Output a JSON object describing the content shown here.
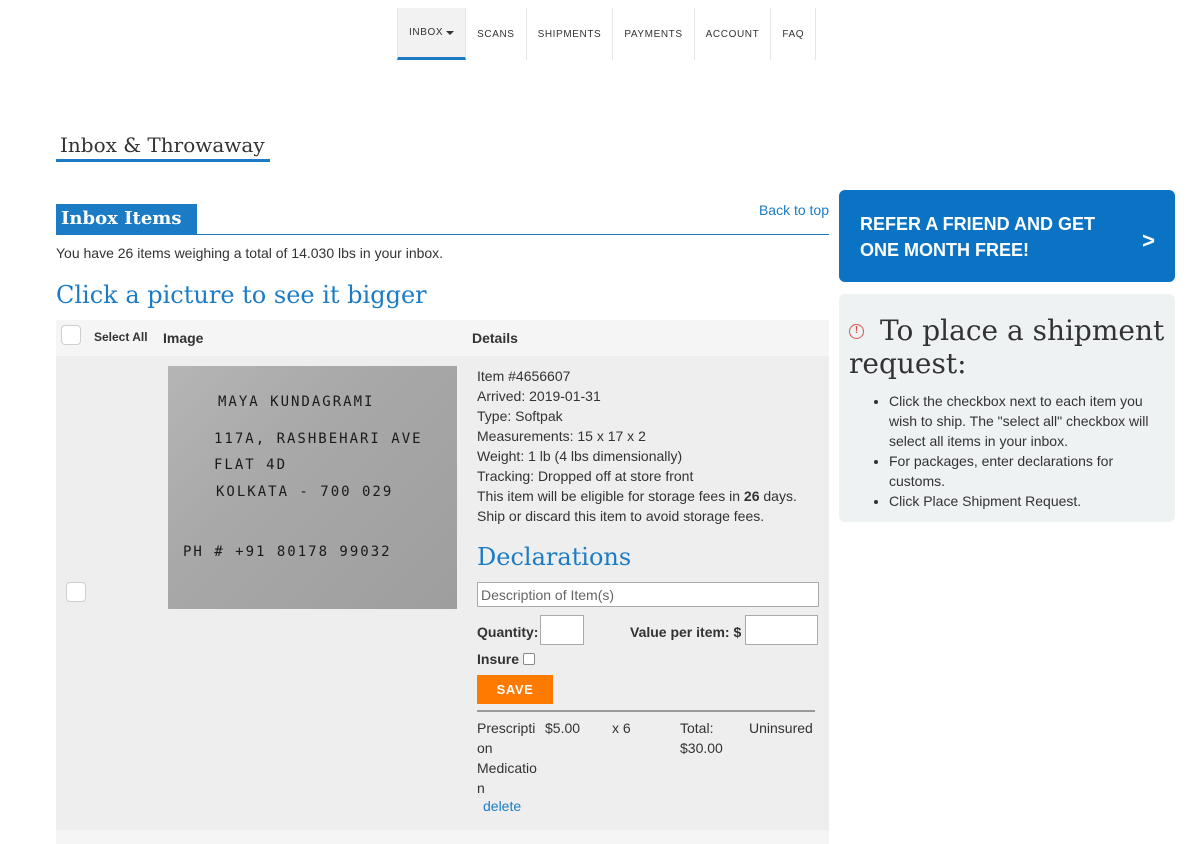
{
  "nav": {
    "items": [
      {
        "label": "INBOX"
      },
      {
        "label": "SCANS"
      },
      {
        "label": "SHIPMENTS"
      },
      {
        "label": "PAYMENTS"
      },
      {
        "label": "ACCOUNT"
      },
      {
        "label": "FAQ"
      }
    ]
  },
  "page_title": "Inbox & Throwaway",
  "inbox": {
    "title": "Inbox Items",
    "back_to_top": "Back to top",
    "summary": "You have 26 items weighing a total of 14.030 lbs in your inbox.",
    "click_prompt": "Click a picture to see it bigger",
    "headers": {
      "select_all": "Select All",
      "image": "Image",
      "details": "Details"
    }
  },
  "item": {
    "image_text": {
      "line1": "MAYA  KUNDAGRAMI",
      "line2": "117A, RASHBEHARI AVE",
      "line3": "FLAT 4D",
      "line4": "KOLKATA - 700 029",
      "line5": "PH # +91 80178 99032"
    },
    "number": "Item #4656607",
    "arrived": "Arrived: 2019-01-31",
    "type": "Type: Softpak",
    "measurements": "Measurements: 15 x 17 x 2",
    "weight": "Weight: 1 lb (4 lbs dimensionally)",
    "tracking": "Tracking: Dropped off at store front",
    "storage_prefix": "This item will be eligible for storage fees in ",
    "storage_days": "26",
    "storage_suffix": " days.",
    "storage_note": "Ship or discard this item to avoid storage fees."
  },
  "declarations": {
    "title": "Declarations",
    "description_placeholder": "Description of Item(s)",
    "quantity_label": "Quantity:",
    "value_label": "Value per item: $",
    "insure_label": "Insure",
    "save_label": "SAVE",
    "entry": {
      "name": "Prescripti\non\nMedicatio\nn",
      "price": "$5.00",
      "qty": "x 6",
      "total": "Total:\n$30.00",
      "insured": "Uninsured",
      "delete_label": "delete"
    }
  },
  "sidebar": {
    "refer_text": "REFER A FRIEND AND GET ONE MONTH FREE!",
    "refer_arrow": ">",
    "ship_title": "To place a shipment request:",
    "instructions": [
      "Click the checkbox next to each item you wish to ship. The \"select all\" checkbox will select all items in your inbox.",
      "For packages, enter declarations for customs.",
      "Click Place Shipment Request."
    ]
  }
}
